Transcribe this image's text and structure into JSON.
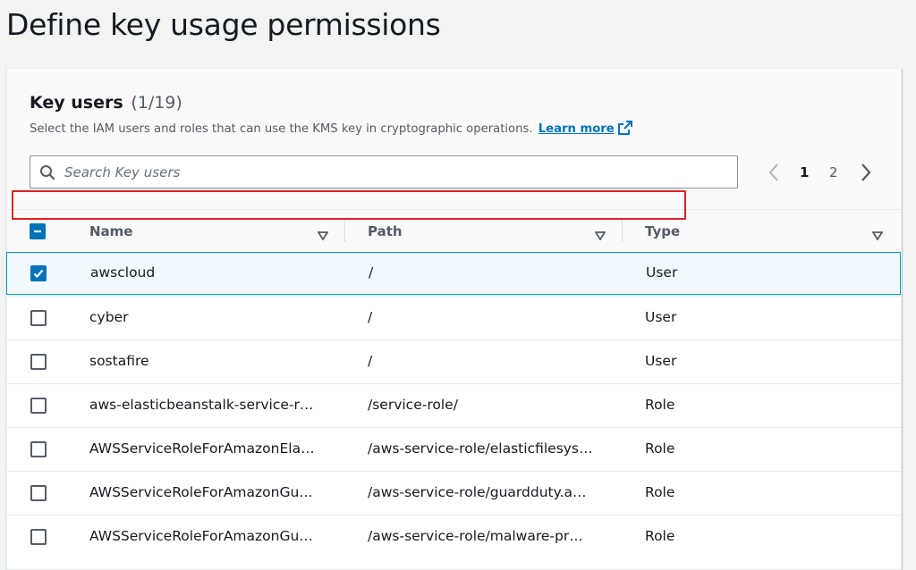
{
  "page_title": "Define key usage permissions",
  "section": {
    "title": "Key users",
    "count": "(1/19)",
    "description": "Select the IAM users and roles that can use the KMS key in cryptographic operations.",
    "learn_more": "Learn more"
  },
  "search": {
    "placeholder": "Search Key users",
    "value": ""
  },
  "pagination": {
    "pages": [
      "1",
      "2"
    ],
    "current": "1"
  },
  "columns": [
    "Name",
    "Path",
    "Type"
  ],
  "rows": [
    {
      "name": "awscloud",
      "path": "/",
      "type": "User",
      "checked": true
    },
    {
      "name": "cyber",
      "path": "/",
      "type": "User",
      "checked": false
    },
    {
      "name": "sostafire",
      "path": "/",
      "type": "User",
      "checked": false
    },
    {
      "name": "aws-elasticbeanstalk-service-r…",
      "path": "/service-role/",
      "type": "Role",
      "checked": false
    },
    {
      "name": "AWSServiceRoleForAmazonEla…",
      "path": "/aws-service-role/elasticfilesys…",
      "type": "Role",
      "checked": false
    },
    {
      "name": "AWSServiceRoleForAmazonGu…",
      "path": "/aws-service-role/guardduty.a…",
      "type": "Role",
      "checked": false
    },
    {
      "name": "AWSServiceRoleForAmazonGu…",
      "path": "/aws-service-role/malware-pr…",
      "type": "Role",
      "checked": false
    }
  ],
  "colors": {
    "accent": "#0073bb",
    "highlight": "#e02020",
    "selected_row_bg": "#f1faff"
  },
  "icons": [
    "search-icon",
    "external-link-icon",
    "chevron-left-icon",
    "chevron-right-icon",
    "sort-caret-icon",
    "checkbox-icon"
  ]
}
